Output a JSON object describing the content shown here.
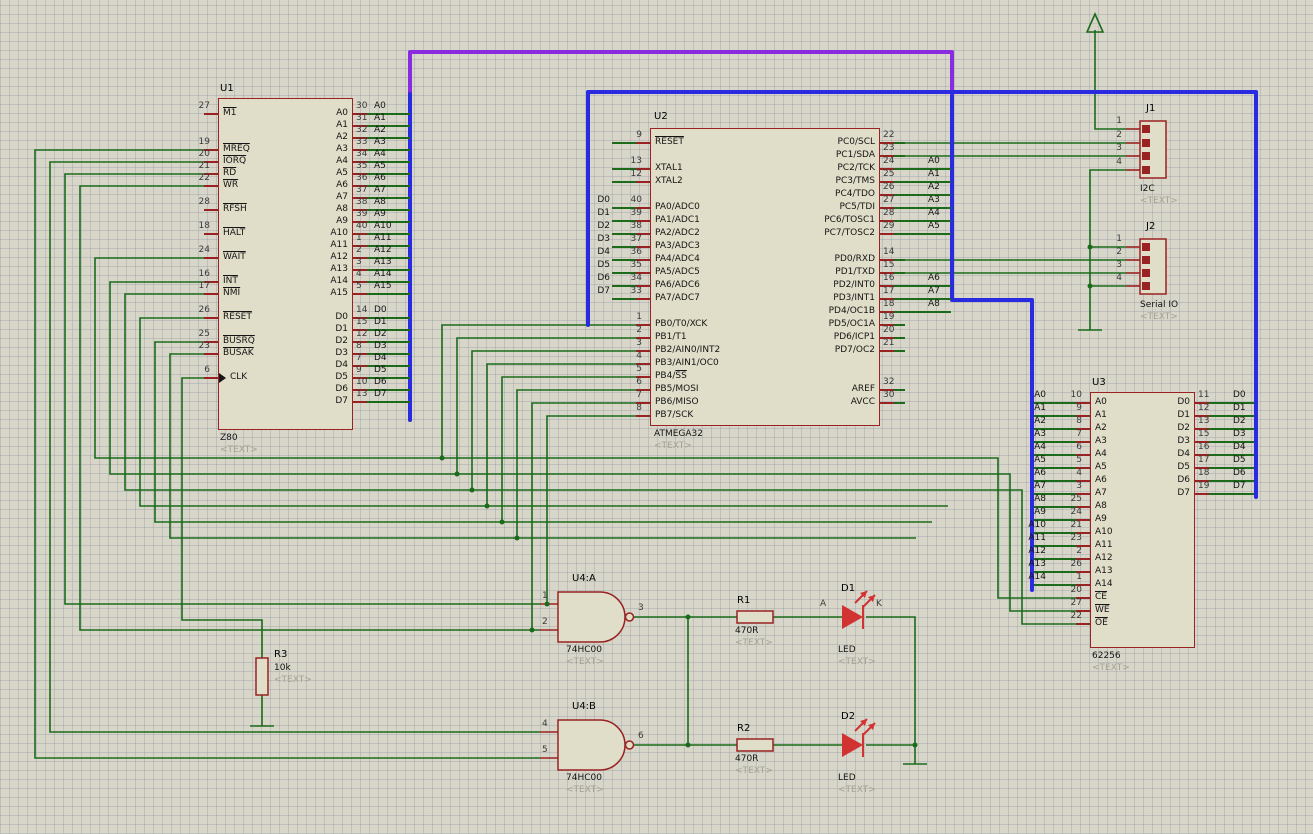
{
  "colors": {
    "wire_green": "#1b6b1b",
    "bus_blue": "#2a2ae0",
    "bus_purple": "#8a2be2",
    "pin_maroon": "#992222",
    "body_fill": "#e0ddc8",
    "led_red": "#d13333"
  },
  "u1": {
    "ref": "U1",
    "value": "Z80",
    "text": "<TEXT>",
    "left": [
      {
        "n": "27",
        "bar": "M1"
      },
      {
        "n": "19",
        "bar": "MREQ",
        "g": 2
      },
      {
        "n": "20",
        "bar": "IORQ"
      },
      {
        "n": "21",
        "bar": "RD"
      },
      {
        "n": "22",
        "bar": "WR"
      },
      {
        "n": "28",
        "bar": "RFSH",
        "g": 1
      },
      {
        "n": "18",
        "bar": "HALT",
        "g": 1
      },
      {
        "n": "24",
        "bar": "WAIT",
        "g": 1
      },
      {
        "n": "16",
        "bar": "INT",
        "g": 1
      },
      {
        "n": "17",
        "bar": "NMI"
      },
      {
        "n": "26",
        "bar": "RESET",
        "g": 1
      },
      {
        "n": "25",
        "bar": "BUSRQ",
        "g": 1
      },
      {
        "n": "23",
        "bar": "BUSAK"
      },
      {
        "n": "6",
        "name": "CLK",
        "clk": true,
        "g": 1
      }
    ],
    "right": [
      {
        "n": "30",
        "name": "A0",
        "net": "A0"
      },
      {
        "n": "31",
        "name": "A1",
        "net": "A1"
      },
      {
        "n": "32",
        "name": "A2",
        "net": "A2"
      },
      {
        "n": "33",
        "name": "A3",
        "net": "A3"
      },
      {
        "n": "34",
        "name": "A4",
        "net": "A4"
      },
      {
        "n": "35",
        "name": "A5",
        "net": "A5"
      },
      {
        "n": "36",
        "name": "A6",
        "net": "A6"
      },
      {
        "n": "37",
        "name": "A7",
        "net": "A7"
      },
      {
        "n": "38",
        "name": "A8",
        "net": "A8"
      },
      {
        "n": "39",
        "name": "A9",
        "net": "A9"
      },
      {
        "n": "40",
        "name": "A10",
        "net": "A10"
      },
      {
        "n": "1",
        "name": "A11",
        "net": "A11"
      },
      {
        "n": "2",
        "name": "A12",
        "net": "A12"
      },
      {
        "n": "3",
        "name": "A13",
        "net": "A13"
      },
      {
        "n": "4",
        "name": "A14",
        "net": "A14"
      },
      {
        "n": "5",
        "name": "A15",
        "net": "A15"
      },
      {
        "n": "14",
        "name": "D0",
        "net": "D0",
        "g": 1
      },
      {
        "n": "15",
        "name": "D1",
        "net": "D1"
      },
      {
        "n": "12",
        "name": "D2",
        "net": "D2"
      },
      {
        "n": "8",
        "name": "D3",
        "net": "D3"
      },
      {
        "n": "7",
        "name": "D4",
        "net": "D4"
      },
      {
        "n": "9",
        "name": "D5",
        "net": "D5"
      },
      {
        "n": "10",
        "name": "D6",
        "net": "D6"
      },
      {
        "n": "13",
        "name": "D7",
        "net": "D7"
      }
    ]
  },
  "u2": {
    "ref": "U2",
    "value": "ATMEGA32",
    "text": "<TEXT>",
    "left": [
      {
        "n": "9",
        "bar": "RESET",
        "w": 1
      },
      {
        "n": "13",
        "name": "XTAL1",
        "g": 1,
        "w": 1
      },
      {
        "n": "12",
        "name": "XTAL2",
        "w": 1
      },
      {
        "n": "40",
        "name": "PA0/ADC0",
        "net": "D0",
        "g": 1
      },
      {
        "n": "39",
        "name": "PA1/ADC1",
        "net": "D1"
      },
      {
        "n": "38",
        "name": "PA2/ADC2",
        "net": "D2"
      },
      {
        "n": "37",
        "name": "PA3/ADC3",
        "net": "D3"
      },
      {
        "n": "36",
        "name": "PA4/ADC4",
        "net": "D4"
      },
      {
        "n": "35",
        "name": "PA5/ADC5",
        "net": "D5"
      },
      {
        "n": "34",
        "name": "PA6/ADC6",
        "net": "D6"
      },
      {
        "n": "33",
        "name": "PA7/ADC7",
        "net": "D7"
      },
      {
        "n": "1",
        "name": "PB0/T0/XCK",
        "g": 1
      },
      {
        "n": "2",
        "name": "PB1/T1"
      },
      {
        "n": "3",
        "name": "PB2/AIN0/INT2"
      },
      {
        "n": "4",
        "name": "PB3/AIN1/OC0"
      },
      {
        "n": "5",
        "name": "PB4/",
        "bar": "SS"
      },
      {
        "n": "6",
        "name": "PB5/MOSI"
      },
      {
        "n": "7",
        "name": "PB6/MISO"
      },
      {
        "n": "8",
        "name": "PB7/SCK"
      }
    ],
    "right": [
      {
        "n": "22",
        "name": "PC0/SCL"
      },
      {
        "n": "23",
        "name": "PC1/SDA"
      },
      {
        "n": "24",
        "name": "PC2/TCK",
        "net": "A0"
      },
      {
        "n": "25",
        "name": "PC3/TMS",
        "net": "A1"
      },
      {
        "n": "26",
        "name": "PC4/TDO",
        "net": "A2"
      },
      {
        "n": "27",
        "name": "PC5/TDI",
        "net": "A3"
      },
      {
        "n": "28",
        "name": "PC6/TOSC1",
        "net": "A4"
      },
      {
        "n": "29",
        "name": "PC7/TOSC2",
        "net": "A5"
      },
      {
        "n": "14",
        "name": "PD0/RXD",
        "g": 1
      },
      {
        "n": "15",
        "name": "PD1/TXD"
      },
      {
        "n": "16",
        "name": "PD2/INT0",
        "net": "A6"
      },
      {
        "n": "17",
        "name": "PD3/INT1",
        "net": "A7"
      },
      {
        "n": "18",
        "name": "PD4/OC1B",
        "net": "A8"
      },
      {
        "n": "19",
        "name": "PD5/OC1A"
      },
      {
        "n": "20",
        "name": "PD6/ICP1"
      },
      {
        "n": "21",
        "name": "PD7/OC2"
      },
      {
        "n": "32",
        "name": "AREF",
        "g": 2
      },
      {
        "n": "30",
        "name": "AVCC"
      }
    ]
  },
  "u3": {
    "ref": "U3",
    "value": "62256",
    "text": "<TEXT>",
    "left": [
      {
        "n": "10",
        "name": "A0",
        "net": "A0"
      },
      {
        "n": "9",
        "name": "A1",
        "net": "A1"
      },
      {
        "n": "8",
        "name": "A2",
        "net": "A2"
      },
      {
        "n": "7",
        "name": "A3",
        "net": "A3"
      },
      {
        "n": "6",
        "name": "A4",
        "net": "A4"
      },
      {
        "n": "5",
        "name": "A5",
        "net": "A5"
      },
      {
        "n": "4",
        "name": "A6",
        "net": "A6"
      },
      {
        "n": "3",
        "name": "A7",
        "net": "A7"
      },
      {
        "n": "25",
        "name": "A8",
        "net": "A8"
      },
      {
        "n": "24",
        "name": "A9",
        "net": "A9"
      },
      {
        "n": "21",
        "name": "A10",
        "net": "A10"
      },
      {
        "n": "23",
        "name": "A11",
        "net": "A11"
      },
      {
        "n": "2",
        "name": "A12",
        "net": "A12"
      },
      {
        "n": "26",
        "name": "A13",
        "net": "A13"
      },
      {
        "n": "1",
        "name": "A14",
        "net": "A14"
      },
      {
        "n": "20",
        "bar": "CE",
        "g": 0
      },
      {
        "n": "27",
        "bar": "WE"
      },
      {
        "n": "22",
        "bar": "OE"
      }
    ],
    "right": [
      {
        "n": "11",
        "name": "D0",
        "net": "D0"
      },
      {
        "n": "12",
        "name": "D1",
        "net": "D1"
      },
      {
        "n": "13",
        "name": "D2",
        "net": "D2"
      },
      {
        "n": "15",
        "name": "D3",
        "net": "D3"
      },
      {
        "n": "16",
        "name": "D4",
        "net": "D4"
      },
      {
        "n": "17",
        "name": "D5",
        "net": "D5"
      },
      {
        "n": "18",
        "name": "D6",
        "net": "D6"
      },
      {
        "n": "19",
        "name": "D7",
        "net": "D7"
      }
    ]
  },
  "u4a": {
    "ref": "U4:A",
    "value": "74HC00",
    "text": "<TEXT>",
    "pin_in1": "1",
    "pin_in2": "2",
    "pin_out": "3"
  },
  "u4b": {
    "ref": "U4:B",
    "value": "74HC00",
    "text": "<TEXT>",
    "pin_in1": "4",
    "pin_in2": "5",
    "pin_out": "6"
  },
  "r1": {
    "ref": "R1",
    "value": "470R",
    "text": "<TEXT>"
  },
  "r2": {
    "ref": "R2",
    "value": "470R",
    "text": "<TEXT>"
  },
  "r3": {
    "ref": "R3",
    "value": "10k",
    "text": "<TEXT>"
  },
  "d1": {
    "ref": "D1",
    "value": "LED",
    "text": "<TEXT>",
    "anode": "A",
    "cathode": "K"
  },
  "d2": {
    "ref": "D2",
    "value": "LED",
    "text": "<TEXT>"
  },
  "j1": {
    "ref": "J1",
    "value": "I2C",
    "text": "<TEXT>",
    "pins": [
      "1",
      "2",
      "3",
      "4"
    ]
  },
  "j2": {
    "ref": "J2",
    "value": "Serial IO",
    "text": "<TEXT>",
    "pins": [
      "1",
      "2",
      "3",
      "4"
    ]
  }
}
